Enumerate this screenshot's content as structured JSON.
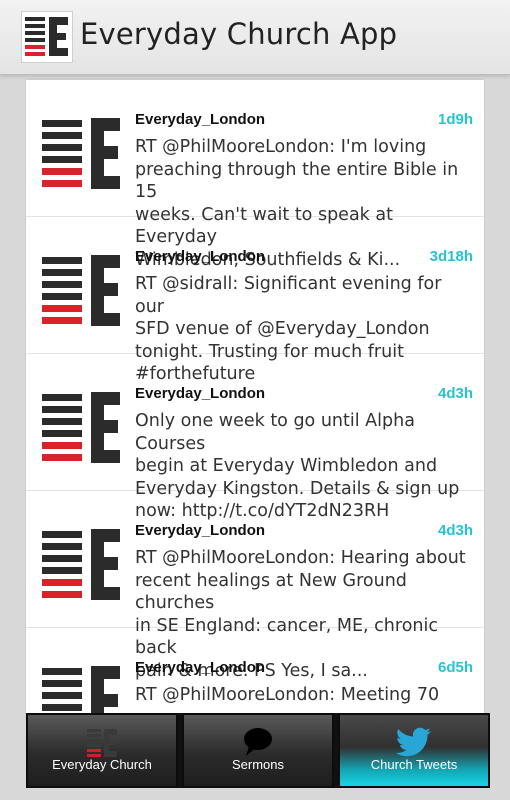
{
  "app": {
    "title": "Everyday Church App"
  },
  "tweets": [
    {
      "user": "Everyday_London",
      "time": "1d9h",
      "lines": [
        "RT @PhilMooreLondon: I'm loving",
        "preaching through the entire Bible in 15",
        "weeks. Can't wait to speak at Everyday",
        "Wimbledon, Southfields & Ki..."
      ]
    },
    {
      "user": "Everyday_London",
      "time": "3d18h",
      "lines": [
        "RT @sidrall: Significant evening for our",
        "SFD venue of @Everyday_London",
        "tonight. Trusting for much fruit",
        "#forthefuture"
      ]
    },
    {
      "user": "Everyday_London",
      "time": "4d3h",
      "lines": [
        "Only one week to go until Alpha Courses",
        "begin at Everyday Wimbledon and",
        "Everyday Kingston. Details & sign up",
        "now: http://t.co/dYT2dN23RH"
      ]
    },
    {
      "user": "Everyday_London",
      "time": "4d3h",
      "lines": [
        "RT @PhilMooreLondon: Hearing about",
        "recent healings at New Ground churches",
        "in SE England: cancer, ME, chronic back",
        "pain & more. PS Yes, I sa..."
      ]
    },
    {
      "user": "Everyday_London",
      "time": "6d5h",
      "lines": [
        "RT @PhilMooreLondon: Meeting 70",
        "",
        "",
        ""
      ]
    }
  ],
  "tabs": [
    {
      "label": "Everyday Church",
      "icon": "everyday-logo-icon",
      "active": false
    },
    {
      "label": "Sermons",
      "icon": "speech-bubble-icon",
      "active": false
    },
    {
      "label": "Church Tweets",
      "icon": "twitter-bird-icon",
      "active": true
    }
  ],
  "colors": {
    "accent": "#25c4d3",
    "active_tab": "#19d3e3",
    "logo_red": "#d8232a",
    "logo_dark": "#2b2b2b"
  }
}
